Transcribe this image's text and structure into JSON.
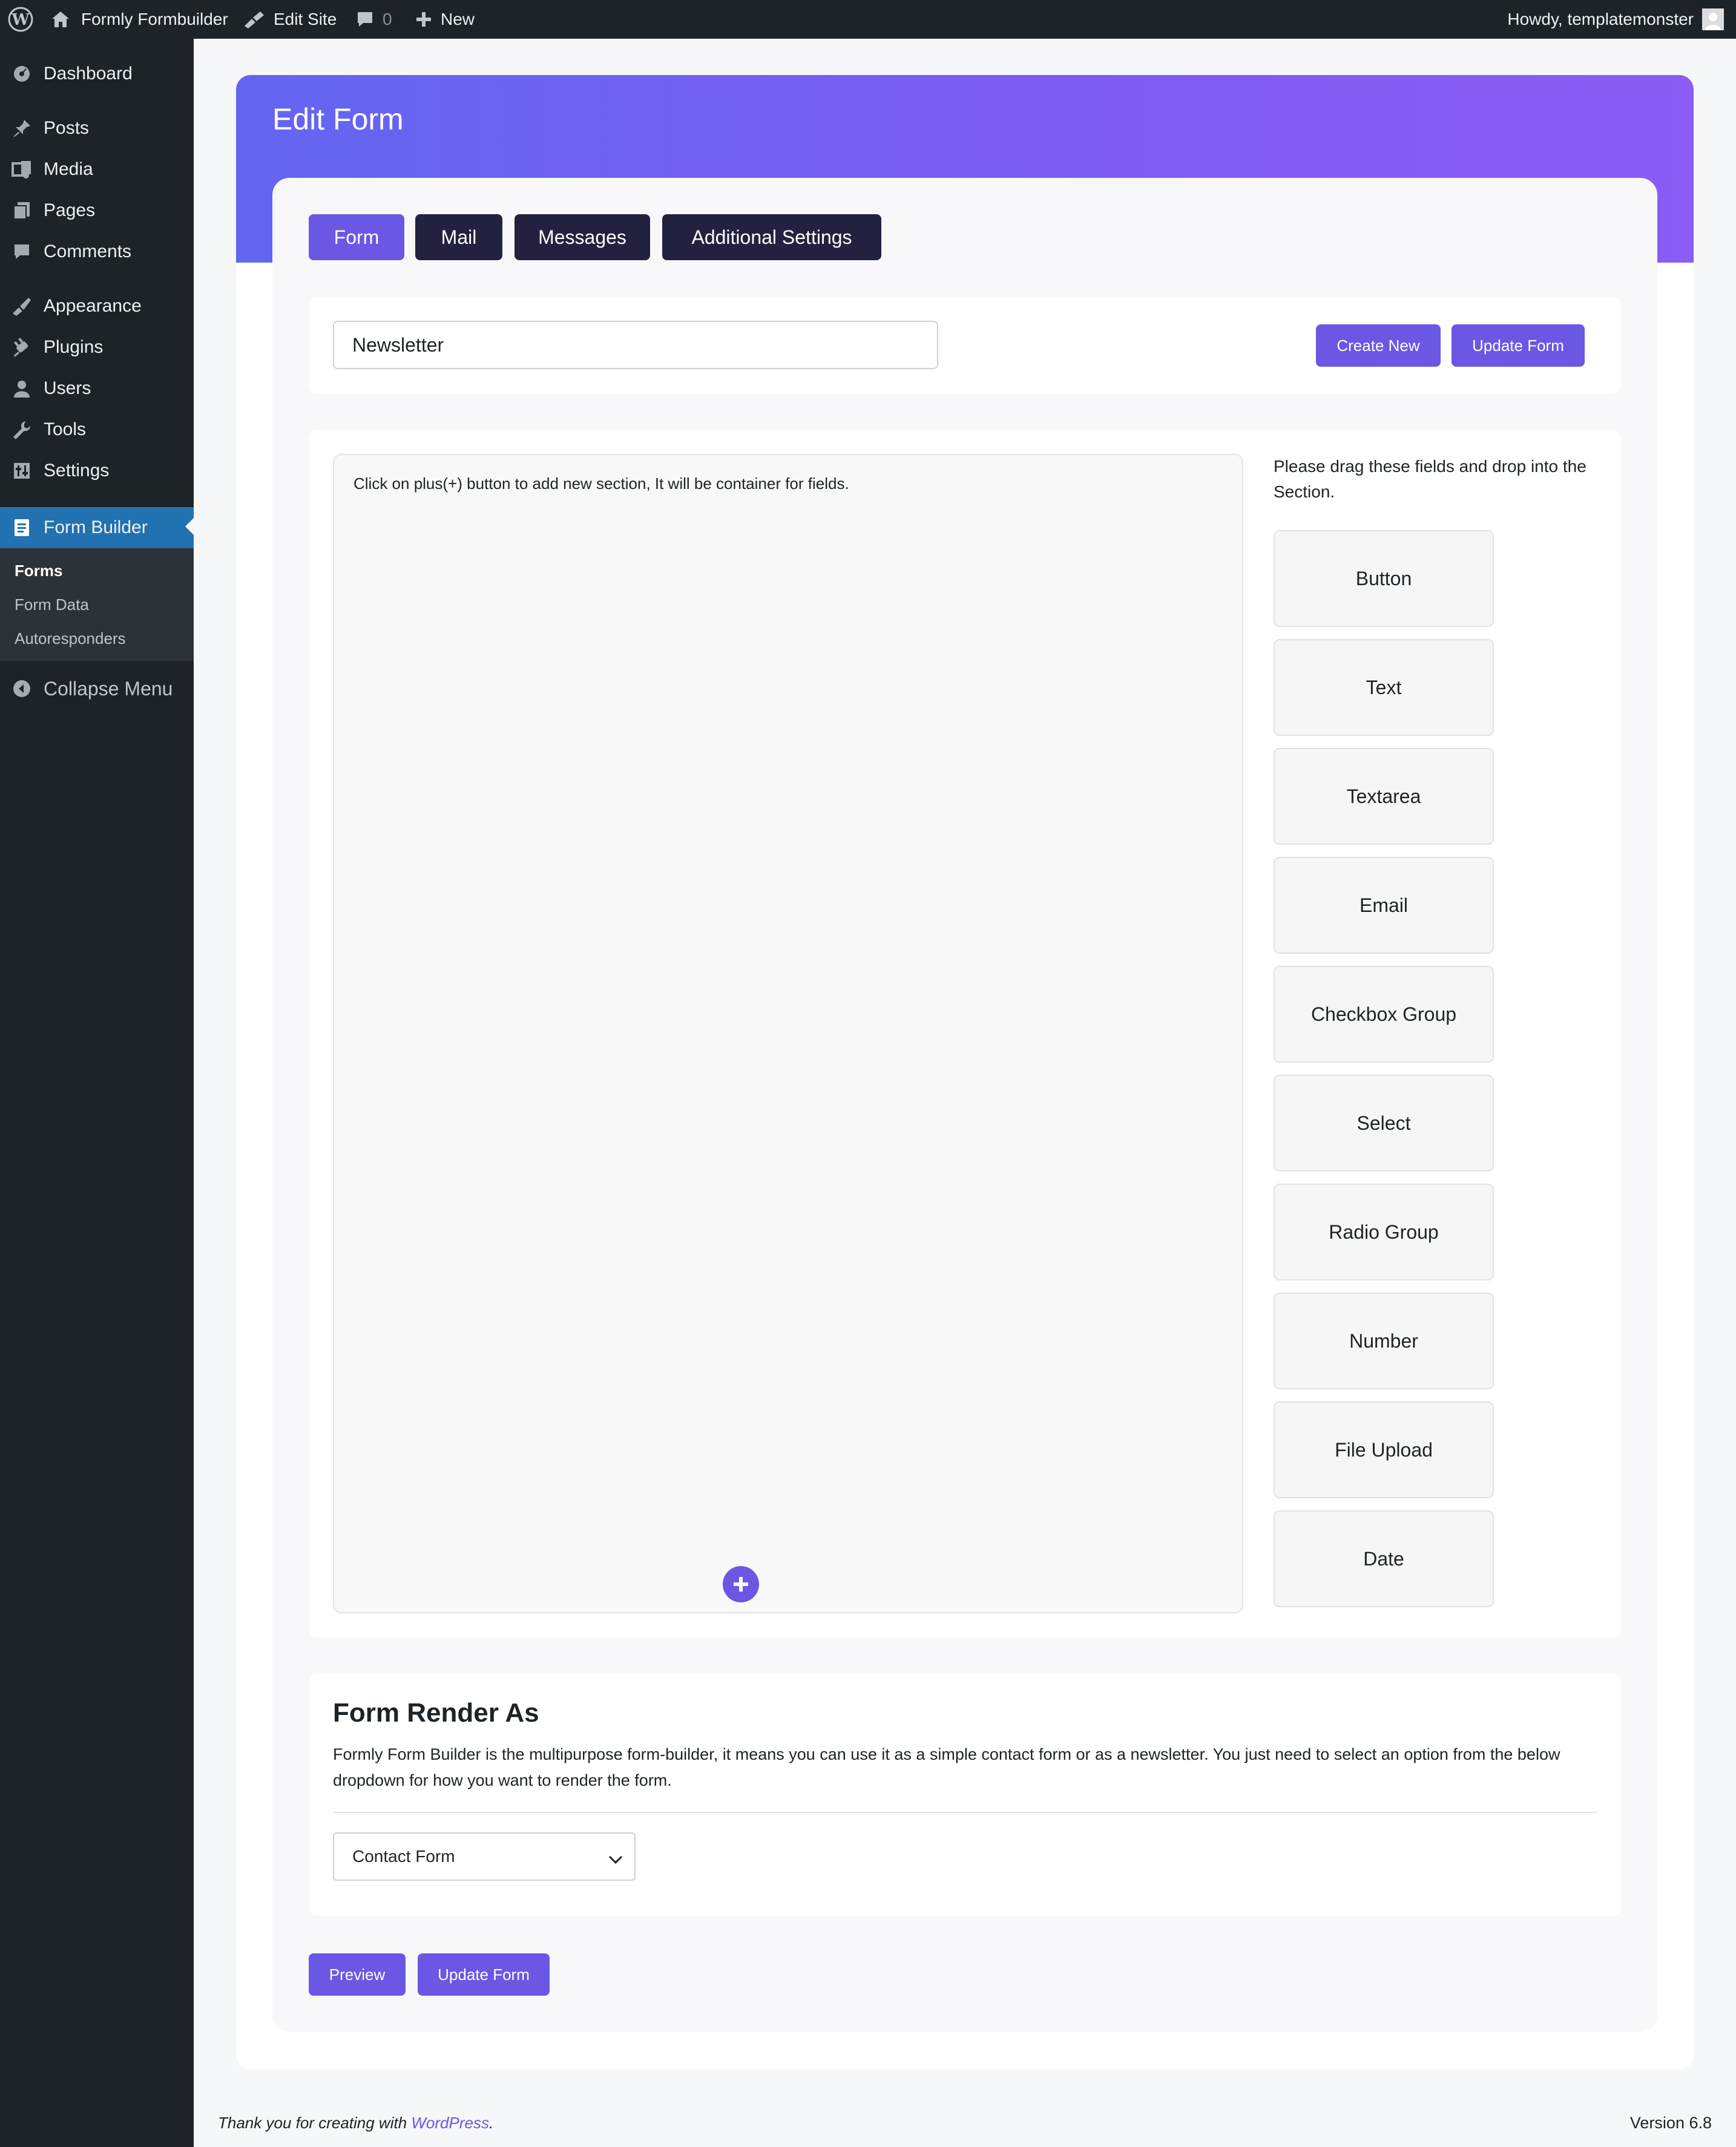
{
  "adminbar": {
    "site_name": "Formly Formbuilder",
    "edit_site": "Edit Site",
    "comments_count": "0",
    "new_label": "New",
    "howdy": "Howdy, templatemonster"
  },
  "sidebar": {
    "items": [
      {
        "label": "Dashboard",
        "icon": "dashboard-icon"
      },
      {
        "label": "Posts",
        "icon": "pin-icon"
      },
      {
        "label": "Media",
        "icon": "media-icon"
      },
      {
        "label": "Pages",
        "icon": "pages-icon"
      },
      {
        "label": "Comments",
        "icon": "comment-icon"
      },
      {
        "label": "Appearance",
        "icon": "brush-icon"
      },
      {
        "label": "Plugins",
        "icon": "plug-icon"
      },
      {
        "label": "Users",
        "icon": "user-icon"
      },
      {
        "label": "Tools",
        "icon": "wrench-icon"
      },
      {
        "label": "Settings",
        "icon": "settings-icon"
      },
      {
        "label": "Form Builder",
        "icon": "form-icon"
      }
    ],
    "submenu": [
      "Forms",
      "Form Data",
      "Autoresponders"
    ],
    "collapse": "Collapse Menu"
  },
  "page": {
    "title": "Edit Form",
    "tabs": [
      "Form",
      "Mail",
      "Messages",
      "Additional Settings"
    ],
    "form_name": "Newsletter",
    "create_new": "Create New",
    "update_form": "Update Form",
    "drop_hint": "Click on plus(+) button to add new section, It will be container for fields.",
    "drag_hint": "Please drag these fields and drop into the Section.",
    "fields": [
      "Button",
      "Text",
      "Textarea",
      "Email",
      "Checkbox Group",
      "Select",
      "Radio Group",
      "Number",
      "File Upload",
      "Date"
    ],
    "render": {
      "title": "Form Render As",
      "description": "Formly Form Builder is the multipurpose form-builder, it means you can use it as a simple contact form or as a newsletter. You just need to select an option from the below dropdown for how you want to render the form.",
      "selected": "Contact Form"
    },
    "preview": "Preview",
    "update_form_bottom": "Update Form"
  },
  "footer": {
    "thanks_prefix": "Thank you for creating with",
    "wordpress": "WordPress",
    "thanks_suffix": ".",
    "version": "Version 6.8"
  },
  "colors": {
    "accent": "#6a57e4",
    "tab_dark": "#222240",
    "wp_blue": "#2271b1",
    "admin_dark": "#1d2327"
  }
}
